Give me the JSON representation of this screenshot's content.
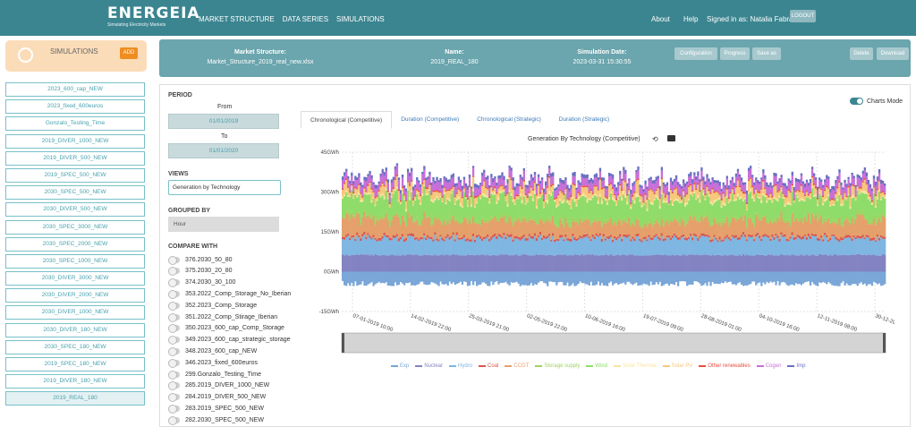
{
  "header": {
    "logo_text": "ENERGEIA",
    "logo_sub": "Simulating Electricity Markets",
    "nav": [
      "MARKET STRUCTURE",
      "DATA SERIES",
      "SIMULATIONS"
    ],
    "about": "About",
    "help": "Help",
    "signed_in": "Signed in as: Natalia Fabra",
    "logout": "LOGOUT"
  },
  "simulations": {
    "label": "SIMULATIONS",
    "add": "ADD",
    "items": [
      "2023_600_cap_NEW",
      "2023_fixed_600euros",
      "Gonzalo_Testing_Time",
      "2019_DIVER_1000_NEW",
      "2019_DIVER_500_NEW",
      "2019_SPEC_500_NEW",
      "2030_SPEC_500_NEW",
      "2030_DIVER_500_NEW",
      "2030_SPEC_3000_NEW",
      "2030_SPEC_2000_NEW",
      "2030_SPEC_1000_NEW",
      "2030_DIVER_3000_NEW",
      "2030_DIVER_2000_NEW",
      "2030_DIVER_1000_NEW",
      "2030_DIVER_180_NEW",
      "2030_SPEC_180_NEW",
      "2019_SPEC_180_NEW",
      "2019_DIVER_180_NEW",
      "2019_REAL_180"
    ],
    "active_index": 18
  },
  "info": {
    "ms_title": "Market Structure:",
    "ms_value": "Market_Structure_2019_real_new.xlsx",
    "name_title": "Name:",
    "name_value": "2019_REAL_180",
    "date_title": "Simulation Date:",
    "date_value": "2023-03-31 15:30:55",
    "buttons": [
      "Configuration",
      "Progress",
      "Save as",
      "Delete",
      "Download"
    ]
  },
  "period": {
    "title": "PERIOD",
    "from_label": "From",
    "from_value": "01/01/2019",
    "to_label": "To",
    "to_value": "01/01/2020"
  },
  "views": {
    "title": "VIEWS",
    "value": "Generation by Technology"
  },
  "grouped": {
    "title": "GROUPED BY",
    "value": "Hour"
  },
  "compare": {
    "title": "COMPARE WITH",
    "items": [
      "376.2030_50_80",
      "375.2030_20_80",
      "374.2030_30_100",
      "353.2022_Comp_Storage_No_Iberian",
      "352.2023_Comp_Storage",
      "351.2022_Comp_Stirage_Iberian",
      "350.2023_600_cap_Comp_Storage",
      "349.2023_600_cap_strategic_storage",
      "348.2023_600_cap_NEW",
      "346.2023_fixed_600euros",
      "299.Gonzalo_Testing_Time",
      "285.2019_DIVER_1000_NEW",
      "284.2019_DIVER_500_NEW",
      "283.2019_SPEC_500_NEW",
      "282.2030_SPEC_500_NEW"
    ]
  },
  "tabs": [
    "Chronological (Competitive)",
    "Duration (Competitive)",
    "Chronological (Strategic)",
    "Duration (Strategic)"
  ],
  "charts_mode": "Charts Mode",
  "chart_data": {
    "type": "area",
    "title": "Generation By Technology (Competitive)",
    "ylim": [
      -15,
      45
    ],
    "y_ticks": [
      "45GWh",
      "30GWh",
      "15GWh",
      "0GWh",
      "-15GWh"
    ],
    "y_tick_values": [
      45,
      30,
      15,
      0,
      -15
    ],
    "x_ticks": [
      "07-01-2019 10:00",
      "14-02-2019 22:00",
      "25-03-2019 21:00",
      "02-05-2019 22:00",
      "10-06-2019 16:00",
      "19-07-2019 09:00",
      "28-08-2019 01:00",
      "04-10-2019 16:00",
      "12-11-2019 08:00",
      "30-12-2019 11:00"
    ],
    "series": [
      {
        "name": "Exp",
        "color": "#7aa6d8",
        "base": -3.5,
        "amp": 2.0
      },
      {
        "name": "Nuclear",
        "color": "#8383c2",
        "base": 6.0,
        "amp": 0.6
      },
      {
        "name": "Hydro",
        "color": "#7fb6e2",
        "base": 5.0,
        "amp": 2.5
      },
      {
        "name": "Coal",
        "color": "#d9574f",
        "base": 0.6,
        "amp": 0.5
      },
      {
        "name": "CCGT",
        "color": "#e5a06b",
        "base": 4.0,
        "amp": 4.0
      },
      {
        "name": "Storage supply",
        "color": "#9fd35f",
        "base": 0.5,
        "amp": 1.0
      },
      {
        "name": "Wind",
        "color": "#8fdc6a",
        "base": 5.0,
        "amp": 4.0
      },
      {
        "name": "Solar Thermal",
        "color": "#f7e5a1",
        "base": 0.6,
        "amp": 0.9
      },
      {
        "name": "Solar PV",
        "color": "#f5c87b",
        "base": 2.5,
        "amp": 3.0
      },
      {
        "name": "Other renewables",
        "color": "#e64e3f",
        "base": 0.4,
        "amp": 0.2
      },
      {
        "name": "Cogen",
        "color": "#c86fd9",
        "base": 2.5,
        "amp": 1.0
      },
      {
        "name": "Imp",
        "color": "#6870c2",
        "base": 0.8,
        "amp": 0.8
      }
    ]
  }
}
